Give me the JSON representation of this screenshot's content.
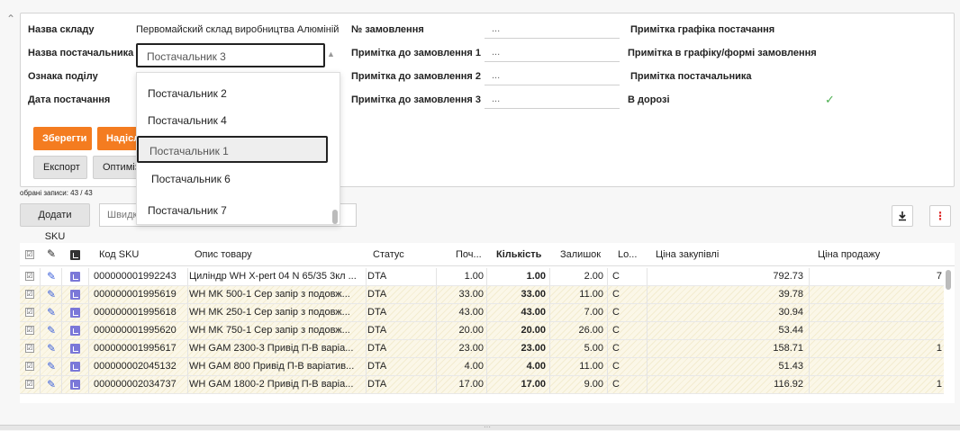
{
  "header": {
    "fields": {
      "warehouse_label": "Назва складу",
      "warehouse_value": "Первомайский склад виробництва Алюміній",
      "supplier_label": "Назва постачальника",
      "division_label": "Ознака поділу",
      "delivery_date_label": "Дата постачання",
      "order_no_label": "№ замовлення",
      "order_no_value": "...",
      "order_note1_label": "Примітка до замовлення 1",
      "order_note1_value": "...",
      "order_note2_label": "Примітка до замовлення 2",
      "order_note2_value": "...",
      "order_note3_label": "Примітка до замовлення 3",
      "order_note3_value": "...",
      "schedule_note_label": "Примітка графіка постачання",
      "schedule_form_note_label": "Примітка в графіку/формі замовлення",
      "supplier_note_label": "Примітка постачальника",
      "in_transit_label": "В дорозі",
      "in_transit_checked": "✓"
    },
    "buttons": {
      "save": "Зберегти",
      "send": "Надіслати",
      "export": "Експорт",
      "optimize": "Оптимізувати"
    }
  },
  "supplier_dropdown": {
    "selected": "Постачальник 3",
    "options": [
      "Постачальник 2",
      "Постачальник 4",
      "Постачальник 1",
      "Постачальник 6",
      "Постачальник 7"
    ],
    "highlighted_index": 2
  },
  "toolbar": {
    "selected_records": "обрані записи: 43 / 43",
    "add_sku": "Додати SKU",
    "quick_search_placeholder": "Швидкий пошук"
  },
  "table": {
    "columns": [
      "Код SKU",
      "Опис товару",
      "Статус",
      "Поч...",
      "Кількість",
      "Залишок",
      "Lo...",
      "Ціна закупівлі",
      "Ціна продажу"
    ],
    "rows": [
      {
        "sku": "000000001992243",
        "desc": "Циліндр WH X-pert 04 N 65/35 3кл ...",
        "status": "DTA",
        "start": "1.00",
        "qty": "1.00",
        "rest": "2.00",
        "lo": "C",
        "purchase": "792.73",
        "sale": "7",
        "hatch": false
      },
      {
        "sku": "000000001995619",
        "desc": "WH MK 500-1 Сер запір з подовж...",
        "status": "DTA",
        "start": "33.00",
        "qty": "33.00",
        "rest": "11.00",
        "lo": "C",
        "purchase": "39.78",
        "sale": "",
        "hatch": true
      },
      {
        "sku": "000000001995618",
        "desc": "WH MK 250-1 Сер запір з подовж...",
        "status": "DTA",
        "start": "43.00",
        "qty": "43.00",
        "rest": "7.00",
        "lo": "C",
        "purchase": "30.94",
        "sale": "",
        "hatch": true
      },
      {
        "sku": "000000001995620",
        "desc": "WH MK 750-1 Сер запір з подовж...",
        "status": "DTA",
        "start": "20.00",
        "qty": "20.00",
        "rest": "26.00",
        "lo": "C",
        "purchase": "53.44",
        "sale": "",
        "hatch": true
      },
      {
        "sku": "000000001995617",
        "desc": "WH GAM 2300-3 Привід П-В варіа...",
        "status": "DTA",
        "start": "23.00",
        "qty": "23.00",
        "rest": "5.00",
        "lo": "C",
        "purchase": "158.71",
        "sale": "1",
        "hatch": true
      },
      {
        "sku": "000000002045132",
        "desc": "WH GAM 800 Привід П-В варіатив...",
        "status": "DTA",
        "start": "4.00",
        "qty": "4.00",
        "rest": "11.00",
        "lo": "C",
        "purchase": "51.43",
        "sale": "",
        "hatch": true
      },
      {
        "sku": "000000002034737",
        "desc": "WH GAM 1800-2 Привід П-В варіа...",
        "status": "DTA",
        "start": "17.00",
        "qty": "17.00",
        "rest": "9.00",
        "lo": "C",
        "purchase": "116.92",
        "sale": "1",
        "hatch": true
      }
    ]
  },
  "icons": {
    "download": "download-icon",
    "more": "more-vertical-icon",
    "check_all": "checkbox-icon",
    "edit": "pencil-icon",
    "chart": "bar-chart-icon"
  }
}
